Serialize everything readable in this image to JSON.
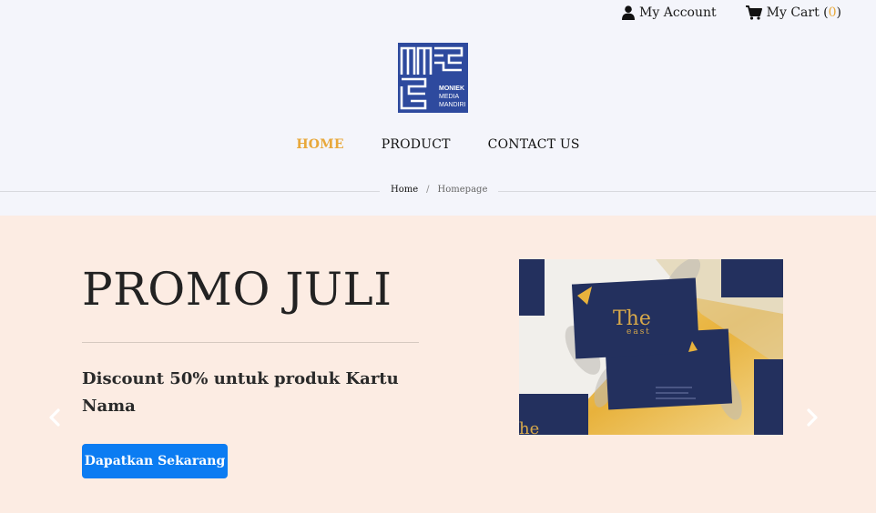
{
  "topbar": {
    "account_label": "My Account",
    "cart_label": "My Cart (",
    "cart_count": "0",
    "cart_close": ")"
  },
  "logo": {
    "line1": "MONIEK",
    "line2": "MEDIA",
    "line3": "MANDIRI",
    "color": "#2e4a9e"
  },
  "nav": {
    "items": [
      {
        "label": "HOME",
        "active": true
      },
      {
        "label": "PRODUCT",
        "active": false
      },
      {
        "label": "CONTACT US",
        "active": false
      }
    ],
    "active_color": "#e8a83a"
  },
  "breadcrumb": {
    "home": "Home",
    "separator": "/",
    "current": "Homepage"
  },
  "hero": {
    "title": "PROMO JULI",
    "subtitle": "Discount 50% untuk produk Kartu Nama",
    "cta_label": "Dapatkan Sekarang",
    "cta_color": "#0b7cf2",
    "background": "#fcece3",
    "image": {
      "card_title": "The",
      "card_subtitle": "east",
      "card_partial": "he",
      "card_color": "#23305e",
      "gold_color": "#e8b23c"
    }
  }
}
